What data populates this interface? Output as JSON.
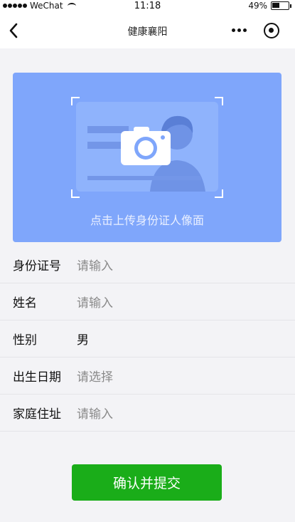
{
  "status_bar": {
    "carrier": "WeChat",
    "time": "11:18",
    "battery_percent": "49%",
    "battery_level": 0.49
  },
  "nav": {
    "title": "健康襄阳",
    "back_icon": "chevron-left-icon",
    "more_icon": "more-dots-icon",
    "target_icon": "target-icon"
  },
  "upload": {
    "label": "点击上传身份证人像面",
    "icon": "camera-icon",
    "background_color": "#7fa6fb"
  },
  "form": {
    "id_number": {
      "label": "身份证号",
      "placeholder": "请输入"
    },
    "name": {
      "label": "姓名",
      "placeholder": "请输入"
    },
    "gender": {
      "label": "性别",
      "value": "男"
    },
    "birth_date": {
      "label": "出生日期",
      "placeholder": "请选择"
    },
    "address": {
      "label": "家庭住址",
      "placeholder": "请输入"
    }
  },
  "submit": {
    "label": "确认并提交",
    "color": "#1aad19"
  }
}
